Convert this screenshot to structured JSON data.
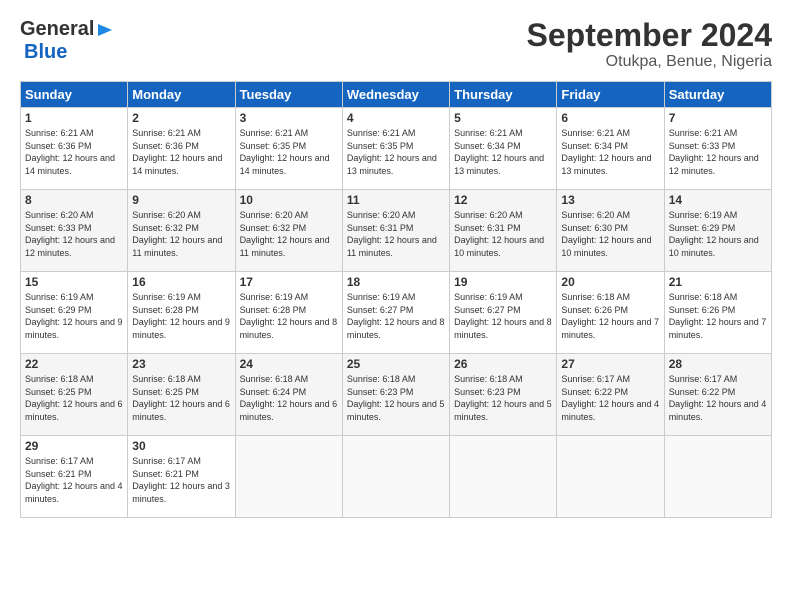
{
  "header": {
    "logo_line1": "General",
    "logo_line2": "Blue",
    "title": "September 2024",
    "subtitle": "Otukpa, Benue, Nigeria"
  },
  "calendar": {
    "days_of_week": [
      "Sunday",
      "Monday",
      "Tuesday",
      "Wednesday",
      "Thursday",
      "Friday",
      "Saturday"
    ],
    "weeks": [
      [
        {
          "day": "1",
          "sunrise": "6:21 AM",
          "sunset": "6:36 PM",
          "daylight": "12 hours and 14 minutes."
        },
        {
          "day": "2",
          "sunrise": "6:21 AM",
          "sunset": "6:36 PM",
          "daylight": "12 hours and 14 minutes."
        },
        {
          "day": "3",
          "sunrise": "6:21 AM",
          "sunset": "6:35 PM",
          "daylight": "12 hours and 14 minutes."
        },
        {
          "day": "4",
          "sunrise": "6:21 AM",
          "sunset": "6:35 PM",
          "daylight": "12 hours and 13 minutes."
        },
        {
          "day": "5",
          "sunrise": "6:21 AM",
          "sunset": "6:34 PM",
          "daylight": "12 hours and 13 minutes."
        },
        {
          "day": "6",
          "sunrise": "6:21 AM",
          "sunset": "6:34 PM",
          "daylight": "12 hours and 13 minutes."
        },
        {
          "day": "7",
          "sunrise": "6:21 AM",
          "sunset": "6:33 PM",
          "daylight": "12 hours and 12 minutes."
        }
      ],
      [
        {
          "day": "8",
          "sunrise": "6:20 AM",
          "sunset": "6:33 PM",
          "daylight": "12 hours and 12 minutes."
        },
        {
          "day": "9",
          "sunrise": "6:20 AM",
          "sunset": "6:32 PM",
          "daylight": "12 hours and 11 minutes."
        },
        {
          "day": "10",
          "sunrise": "6:20 AM",
          "sunset": "6:32 PM",
          "daylight": "12 hours and 11 minutes."
        },
        {
          "day": "11",
          "sunrise": "6:20 AM",
          "sunset": "6:31 PM",
          "daylight": "12 hours and 11 minutes."
        },
        {
          "day": "12",
          "sunrise": "6:20 AM",
          "sunset": "6:31 PM",
          "daylight": "12 hours and 10 minutes."
        },
        {
          "day": "13",
          "sunrise": "6:20 AM",
          "sunset": "6:30 PM",
          "daylight": "12 hours and 10 minutes."
        },
        {
          "day": "14",
          "sunrise": "6:19 AM",
          "sunset": "6:29 PM",
          "daylight": "12 hours and 10 minutes."
        }
      ],
      [
        {
          "day": "15",
          "sunrise": "6:19 AM",
          "sunset": "6:29 PM",
          "daylight": "12 hours and 9 minutes."
        },
        {
          "day": "16",
          "sunrise": "6:19 AM",
          "sunset": "6:28 PM",
          "daylight": "12 hours and 9 minutes."
        },
        {
          "day": "17",
          "sunrise": "6:19 AM",
          "sunset": "6:28 PM",
          "daylight": "12 hours and 8 minutes."
        },
        {
          "day": "18",
          "sunrise": "6:19 AM",
          "sunset": "6:27 PM",
          "daylight": "12 hours and 8 minutes."
        },
        {
          "day": "19",
          "sunrise": "6:19 AM",
          "sunset": "6:27 PM",
          "daylight": "12 hours and 8 minutes."
        },
        {
          "day": "20",
          "sunrise": "6:18 AM",
          "sunset": "6:26 PM",
          "daylight": "12 hours and 7 minutes."
        },
        {
          "day": "21",
          "sunrise": "6:18 AM",
          "sunset": "6:26 PM",
          "daylight": "12 hours and 7 minutes."
        }
      ],
      [
        {
          "day": "22",
          "sunrise": "6:18 AM",
          "sunset": "6:25 PM",
          "daylight": "12 hours and 6 minutes."
        },
        {
          "day": "23",
          "sunrise": "6:18 AM",
          "sunset": "6:25 PM",
          "daylight": "12 hours and 6 minutes."
        },
        {
          "day": "24",
          "sunrise": "6:18 AM",
          "sunset": "6:24 PM",
          "daylight": "12 hours and 6 minutes."
        },
        {
          "day": "25",
          "sunrise": "6:18 AM",
          "sunset": "6:23 PM",
          "daylight": "12 hours and 5 minutes."
        },
        {
          "day": "26",
          "sunrise": "6:18 AM",
          "sunset": "6:23 PM",
          "daylight": "12 hours and 5 minutes."
        },
        {
          "day": "27",
          "sunrise": "6:17 AM",
          "sunset": "6:22 PM",
          "daylight": "12 hours and 4 minutes."
        },
        {
          "day": "28",
          "sunrise": "6:17 AM",
          "sunset": "6:22 PM",
          "daylight": "12 hours and 4 minutes."
        }
      ],
      [
        {
          "day": "29",
          "sunrise": "6:17 AM",
          "sunset": "6:21 PM",
          "daylight": "12 hours and 4 minutes."
        },
        {
          "day": "30",
          "sunrise": "6:17 AM",
          "sunset": "6:21 PM",
          "daylight": "12 hours and 3 minutes."
        },
        null,
        null,
        null,
        null,
        null
      ]
    ]
  }
}
